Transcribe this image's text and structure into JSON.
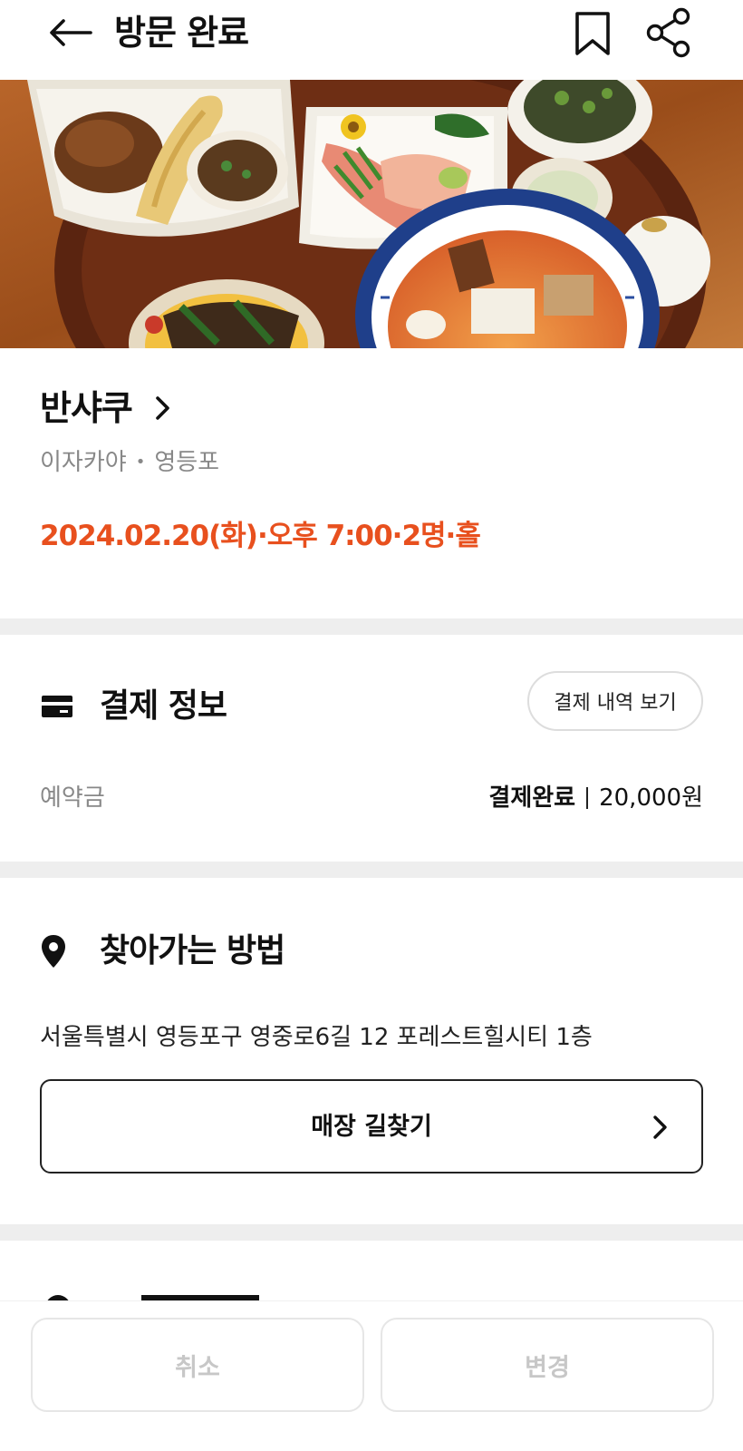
{
  "header": {
    "title": "방문 완료",
    "back_icon": "back-arrow-icon",
    "bookmark_icon": "bookmark-icon",
    "share_icon": "share-icon"
  },
  "restaurant": {
    "name": "반샤쿠",
    "category": "이자카야",
    "area": "영등포",
    "booking_info": "2024.02.20(화)·오후 7:00·2명·홀"
  },
  "payment": {
    "title": "결제 정보",
    "history_button": "결제 내역 보기",
    "deposit_label": "예약금",
    "status": "결제완료",
    "amount": "20,000원"
  },
  "directions": {
    "title": "찾아가는 방법",
    "address": "서울특별시 영등포구 영중로6길 12 포레스트힐시티 1층",
    "button_label": "매장 길찾기"
  },
  "actions": {
    "cancel_label": "취소",
    "change_label": "변경"
  },
  "colors": {
    "accent": "#e8501e",
    "muted_text": "#888888",
    "divider": "#eeeeee",
    "disabled_text": "#c7c7c7"
  }
}
